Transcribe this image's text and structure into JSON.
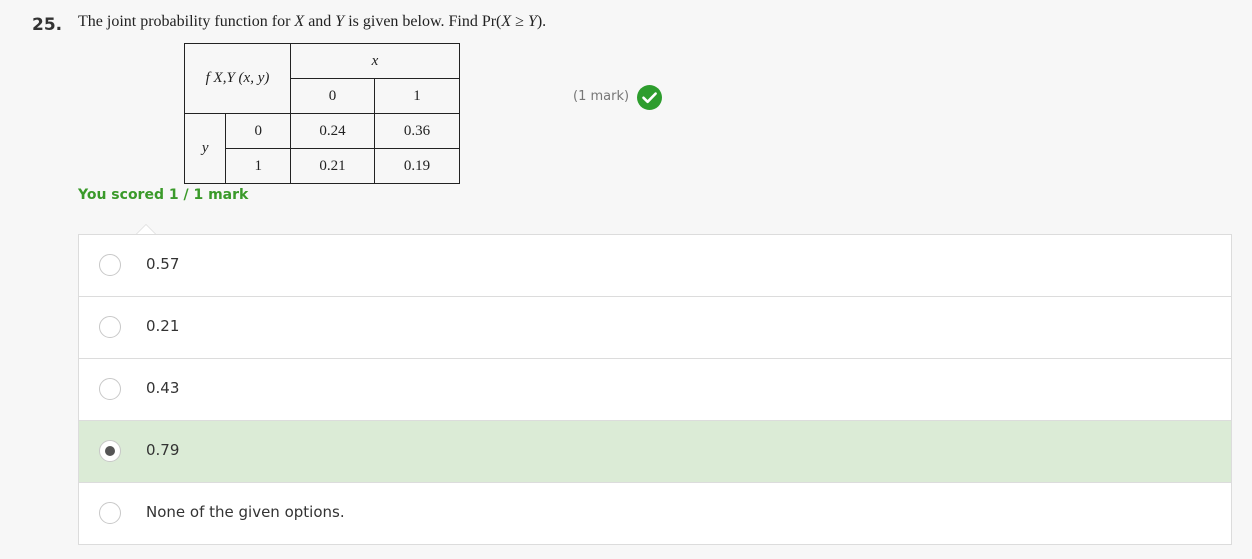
{
  "question": {
    "number": "25.",
    "text_before": "The joint probability function for ",
    "var_x": "X",
    "text_and": " and ",
    "var_y": "Y",
    "text_find": " is given below. Find Pr(",
    "expr": "X ≥ Y",
    "text_end": ")."
  },
  "table": {
    "header_label": "f X,Y (x, y)",
    "x_label": "x",
    "y_label": "y",
    "x_values": [
      "0",
      "1"
    ],
    "rows": [
      {
        "y": "0",
        "cells": [
          "0.24",
          "0.36"
        ]
      },
      {
        "y": "1",
        "cells": [
          "0.21",
          "0.19"
        ]
      }
    ]
  },
  "marks_label": "(1 mark)",
  "score_text": "You scored 1 / 1 mark",
  "options": [
    {
      "label": "0.57",
      "selected": false
    },
    {
      "label": "0.21",
      "selected": false
    },
    {
      "label": "0.43",
      "selected": false
    },
    {
      "label": "0.79",
      "selected": true
    },
    {
      "label": "None of the given options.",
      "selected": false
    }
  ],
  "colors": {
    "correct_green": "#2d9d2d",
    "selected_bg": "#dbebd6",
    "score_green": "#3a9a2a"
  },
  "icons": {
    "check": "check-circle-icon"
  }
}
